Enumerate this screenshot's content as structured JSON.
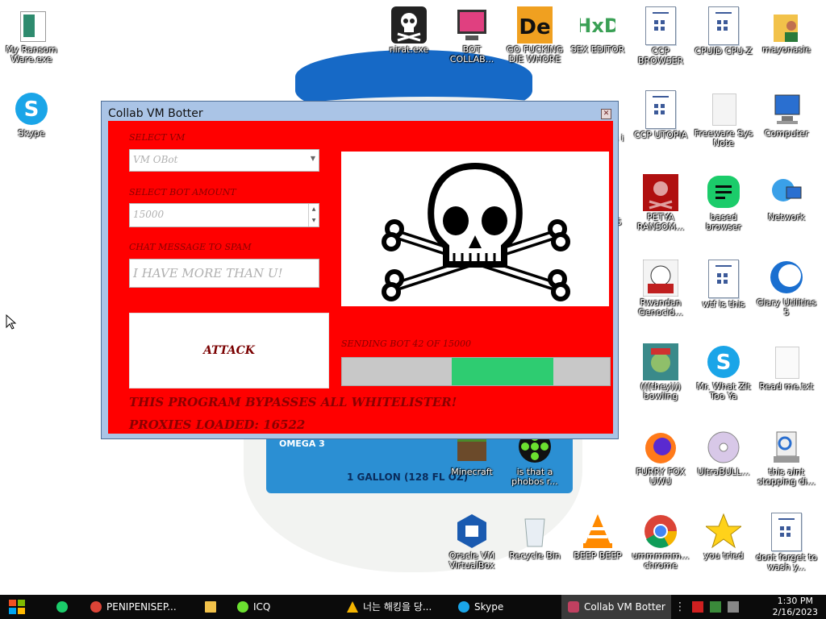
{
  "desktop": {
    "icons": [
      {
        "label": "My Ransom Ware.exe",
        "icon": "ransomware-icon"
      },
      {
        "label": "Skype",
        "icon": "skype-icon"
      },
      {
        "label": "nirat.exe",
        "icon": "skull-icon"
      },
      {
        "label": "BOT COLLAB...",
        "icon": "monitor-icon"
      },
      {
        "label": "GO FUCKING DIE WHORE",
        "icon": "de-icon"
      },
      {
        "label": "SEX EDITOR",
        "icon": "hxd-icon"
      },
      {
        "label": "CCP BROWSER",
        "icon": "document-icon"
      },
      {
        "label": "CPUID CPU-Z",
        "icon": "document-icon"
      },
      {
        "label": "mayonasie",
        "icon": "user-folder-icon"
      },
      {
        "label": "CCP UTOPIA",
        "icon": "document-icon"
      },
      {
        "label": "Freeware Sys Note",
        "icon": "blank-document-icon"
      },
      {
        "label": "Computer",
        "icon": "computer-icon"
      },
      {
        "label": "PETYA RANSOM...",
        "icon": "petya-icon"
      },
      {
        "label": "based browser",
        "icon": "chat-icon"
      },
      {
        "label": "Network",
        "icon": "network-icon"
      },
      {
        "label": "Rwandan Genocid...",
        "icon": "meme-icon"
      },
      {
        "label": "wtf is this",
        "icon": "document-icon"
      },
      {
        "label": "Glary Utilities 5",
        "icon": "glary-icon"
      },
      {
        "label": "(((they))) bowling",
        "icon": "troll-icon"
      },
      {
        "label": "Mr. What Zit Too Ya",
        "icon": "skype-icon"
      },
      {
        "label": "Read me.txt",
        "icon": "text-file-icon"
      },
      {
        "label": "Minecraft",
        "icon": "minecraft-icon"
      },
      {
        "label": "is that a phobos r...",
        "icon": "icq-icon"
      },
      {
        "label": "FURRY FOX UWU",
        "icon": "firefox-icon"
      },
      {
        "label": "UltraBULL...",
        "icon": "disc-icon"
      },
      {
        "label": "this aint stopping di...",
        "icon": "installer-icon"
      },
      {
        "label": "Oracle VM VirtualBox",
        "icon": "virtualbox-icon"
      },
      {
        "label": "Recycle Bin",
        "icon": "recycle-bin-icon"
      },
      {
        "label": "BEEP BEEP",
        "icon": "vlc-icon"
      },
      {
        "label": "ummmmm... chrome",
        "icon": "chrome-icon"
      },
      {
        "label": "you tried",
        "icon": "star-icon"
      },
      {
        "label": "dont forget to wash y...",
        "icon": "document-icon"
      }
    ],
    "partial_labels": [
      "s i",
      "S"
    ],
    "wallpaper": {
      "label_text": "1 GALLON (128 FL OZ)",
      "brand_text": "OMEGA 3"
    }
  },
  "window": {
    "title": "Collab VM Botter",
    "select_vm_label": "SELECT VM",
    "select_vm_value": "VM OBot",
    "bot_amount_label": "SELECT BOT AMOUNT",
    "bot_amount_value": "15000",
    "chat_label": "CHAT MESSAGE TO SPAM",
    "chat_value": "I HAVE MORE THAN U!",
    "attack_label": "ATTACK",
    "sending_status": "SENDING BOT 42 OF 15000",
    "progress_start": 0.41,
    "progress_end": 0.79,
    "bypass_text": "THIS PROGRAM BYPASSES ALL WHITELISTER!",
    "proxies_text": "PROXIES LOADED: 16522",
    "accent": "#ff0000",
    "progress_color": "#2ecc71"
  },
  "taskbar": {
    "items": [
      {
        "label": "PENIPENISEP...",
        "icon": "chrome-icon"
      },
      {
        "label": "",
        "icon": "folder-icon"
      },
      {
        "label": "ICQ",
        "icon": "icq-icon"
      },
      {
        "label": "너는 해킹을 당...",
        "icon": "warning-icon"
      },
      {
        "label": "Skype",
        "icon": "skype-icon"
      },
      {
        "label": "Collab VM Botter",
        "icon": "app-icon"
      }
    ],
    "time": "1:30 PM",
    "date": "2/16/2023"
  }
}
